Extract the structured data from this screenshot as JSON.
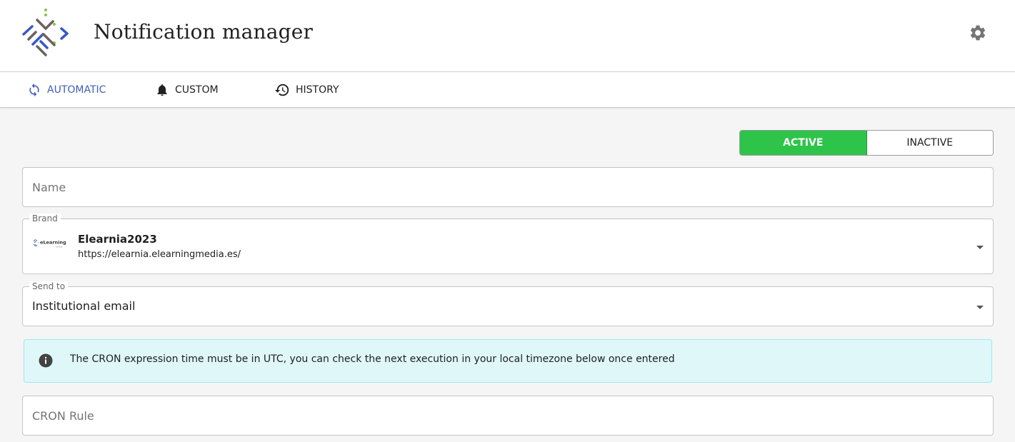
{
  "app": {
    "title": "Notification manager",
    "logo_icon": "brand-logo-icon",
    "settings_icon": "gear-icon"
  },
  "tabs": [
    {
      "label": "AUTOMATIC",
      "icon": "refresh-icon",
      "active": true
    },
    {
      "label": "CUSTOM",
      "icon": "bell-icon",
      "active": false
    },
    {
      "label": "HISTORY",
      "icon": "history-icon",
      "active": false
    }
  ],
  "status_toggle": {
    "active_label": "ACTIVE",
    "inactive_label": "INACTIVE",
    "selected": "ACTIVE",
    "active_color": "#2ec44a"
  },
  "form": {
    "name": {
      "placeholder": "Name",
      "value": ""
    },
    "brand": {
      "label": "Brand",
      "selected_name": "Elearnia2023",
      "selected_url": "https://elearnia.elearningmedia.es/",
      "logo_text": "eLearning"
    },
    "send_to": {
      "label": "Send to",
      "value": "Institutional email"
    },
    "info_alert": {
      "icon": "info-icon",
      "text": "The CRON expression time must be in UTC, you can check the next execution in your local timezone below once entered"
    },
    "cron_rule": {
      "placeholder": "CRON Rule",
      "value": ""
    }
  },
  "colors": {
    "accent": "#3f5fbf",
    "active_green": "#2ec44a",
    "alert_bg": "#dff7f9"
  }
}
